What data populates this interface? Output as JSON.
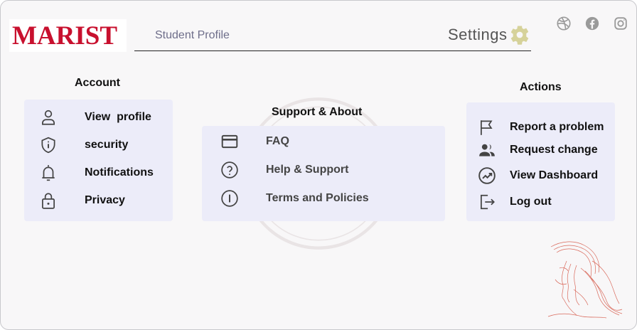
{
  "brand": {
    "logo_text": "MARIST"
  },
  "nav": {
    "profile_tab": "Student Profile",
    "settings_label": "Settings"
  },
  "social_links": [
    {
      "icon": "dribbble-icon"
    },
    {
      "icon": "facebook-icon"
    },
    {
      "icon": "instagram-icon"
    }
  ],
  "account": {
    "heading": "Account",
    "items": [
      {
        "label": "View  profile",
        "icon": "user-icon"
      },
      {
        "label": "security",
        "icon": "shield-icon"
      },
      {
        "label": "Notifications",
        "icon": "bell-icon"
      },
      {
        "label": "Privacy",
        "icon": "lock-icon"
      }
    ]
  },
  "support": {
    "heading": "Support & About",
    "items": [
      {
        "label": "FAQ",
        "icon": "card-icon"
      },
      {
        "label": "Help & Support",
        "icon": "question-icon"
      },
      {
        "label": "Terms and Policies",
        "icon": "info-icon"
      }
    ]
  },
  "actions": {
    "heading": "Actions",
    "items": [
      {
        "label": "Report a problem",
        "icon": "flag-icon"
      },
      {
        "label": "Request change",
        "icon": "users-icon"
      },
      {
        "label": "View Dashboard",
        "icon": "dashboard-icon"
      },
      {
        "label": "Log out",
        "icon": "logout-icon"
      }
    ]
  },
  "colors": {
    "brand_red": "#c8102e",
    "panel_bg": "#ececf9",
    "gear": "#d6d29a",
    "sketch": "#d96a5c"
  }
}
